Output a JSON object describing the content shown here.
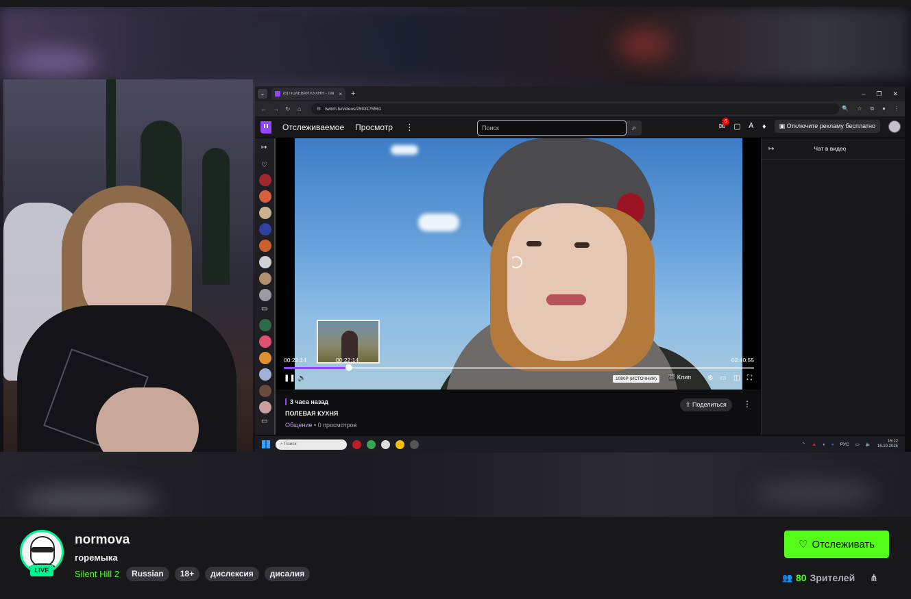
{
  "browser": {
    "tab_title": "(6) ПОЛЕВАЯ КУХНЯ - Тwi",
    "tab_close": "×",
    "new_tab": "+",
    "url": "twitch.tv/videos/2593175561"
  },
  "twitch": {
    "nav": [
      "Отслеживаемое",
      "Просмотр"
    ],
    "search_placeholder": "Поиск",
    "notifications": "6",
    "ads_button": "Отключите рекламу бесплатно"
  },
  "player": {
    "hover_time": "00:22:14",
    "current_time": "00:22:14",
    "duration": "02:40:55",
    "progress": 0.138,
    "quality": "1080P (ИСТОЧНИК)",
    "clip_label": "Клип"
  },
  "video_info": {
    "ago": "3 часа назад",
    "title": "ПОЛЕВАЯ КУХНЯ",
    "category": "Общение",
    "views": " • 0 просмотров",
    "share_label": "Поделиться"
  },
  "chat": {
    "title": "Чат в видео"
  },
  "taskbar": {
    "search": "Поиск",
    "lang": "РУС",
    "time": "15:12",
    "date": "16.10.2025"
  },
  "channel": {
    "name": "normova",
    "live_label": "LIVE",
    "stream_title": "горемыка",
    "game": "Silent Hill 2",
    "tags": [
      "Russian",
      "18+",
      "дислексия",
      "дисалия"
    ],
    "follow_label": "Отслеживать",
    "viewer_count": "80",
    "viewer_label": "Зрителей"
  },
  "colors": {
    "accent": "#53fc18",
    "twitch_purple": "#9147ff",
    "live_ring": "#00f593"
  }
}
